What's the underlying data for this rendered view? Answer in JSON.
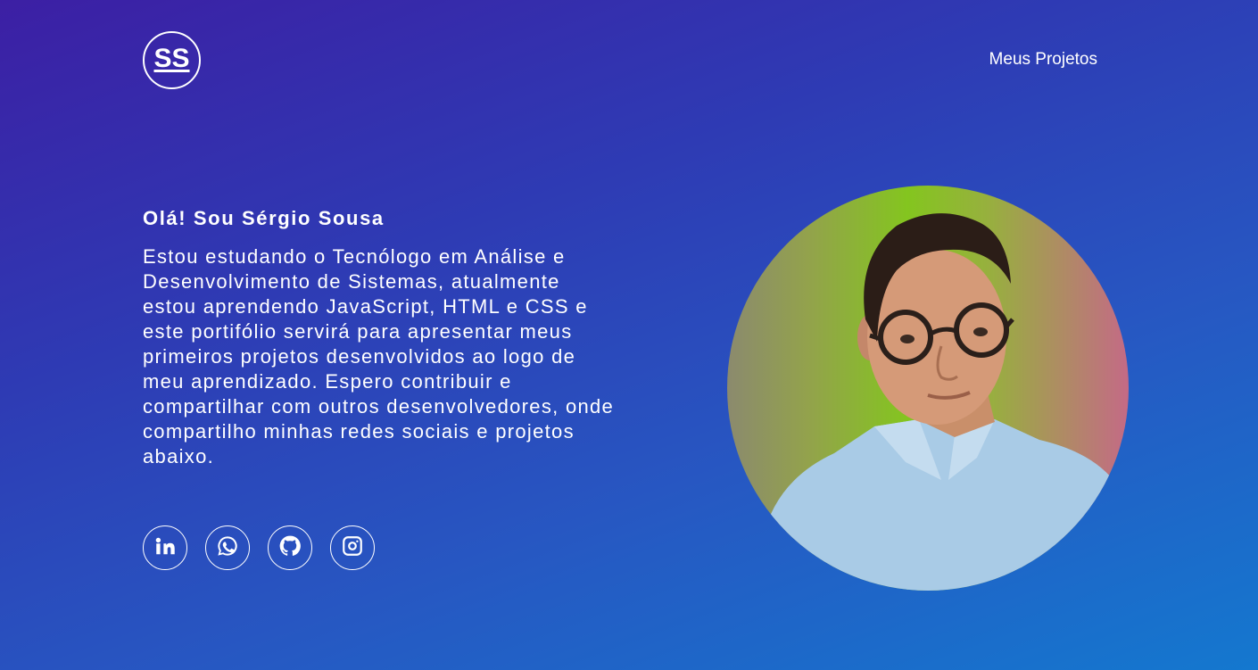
{
  "header": {
    "logo_text": "SS",
    "nav_link": "Meus Projetos"
  },
  "intro": {
    "title": "Olá! Sou Sérgio Sousa",
    "text": "Estou estudando o Tecnólogo em Análise e Desenvolvimento de Sistemas, atualmente estou aprendendo JavaScript, HTML e CSS e este portifólio servirá para apresentar meus primeiros projetos desenvolvidos ao logo de meu aprendizado. Espero contribuir e compartilhar com outros desenvolvedores, onde compartilho minhas redes sociais e projetos abaixo."
  },
  "socials": [
    {
      "icon": "linkedin-icon"
    },
    {
      "icon": "whatsapp-icon"
    },
    {
      "icon": "github-icon"
    },
    {
      "icon": "instagram-icon"
    }
  ],
  "colors": {
    "background_start": "#3c1fa4",
    "background_end": "#1478cf",
    "text": "#ffffff",
    "portrait_green": "#84c51f",
    "portrait_pink": "#c46a86"
  }
}
